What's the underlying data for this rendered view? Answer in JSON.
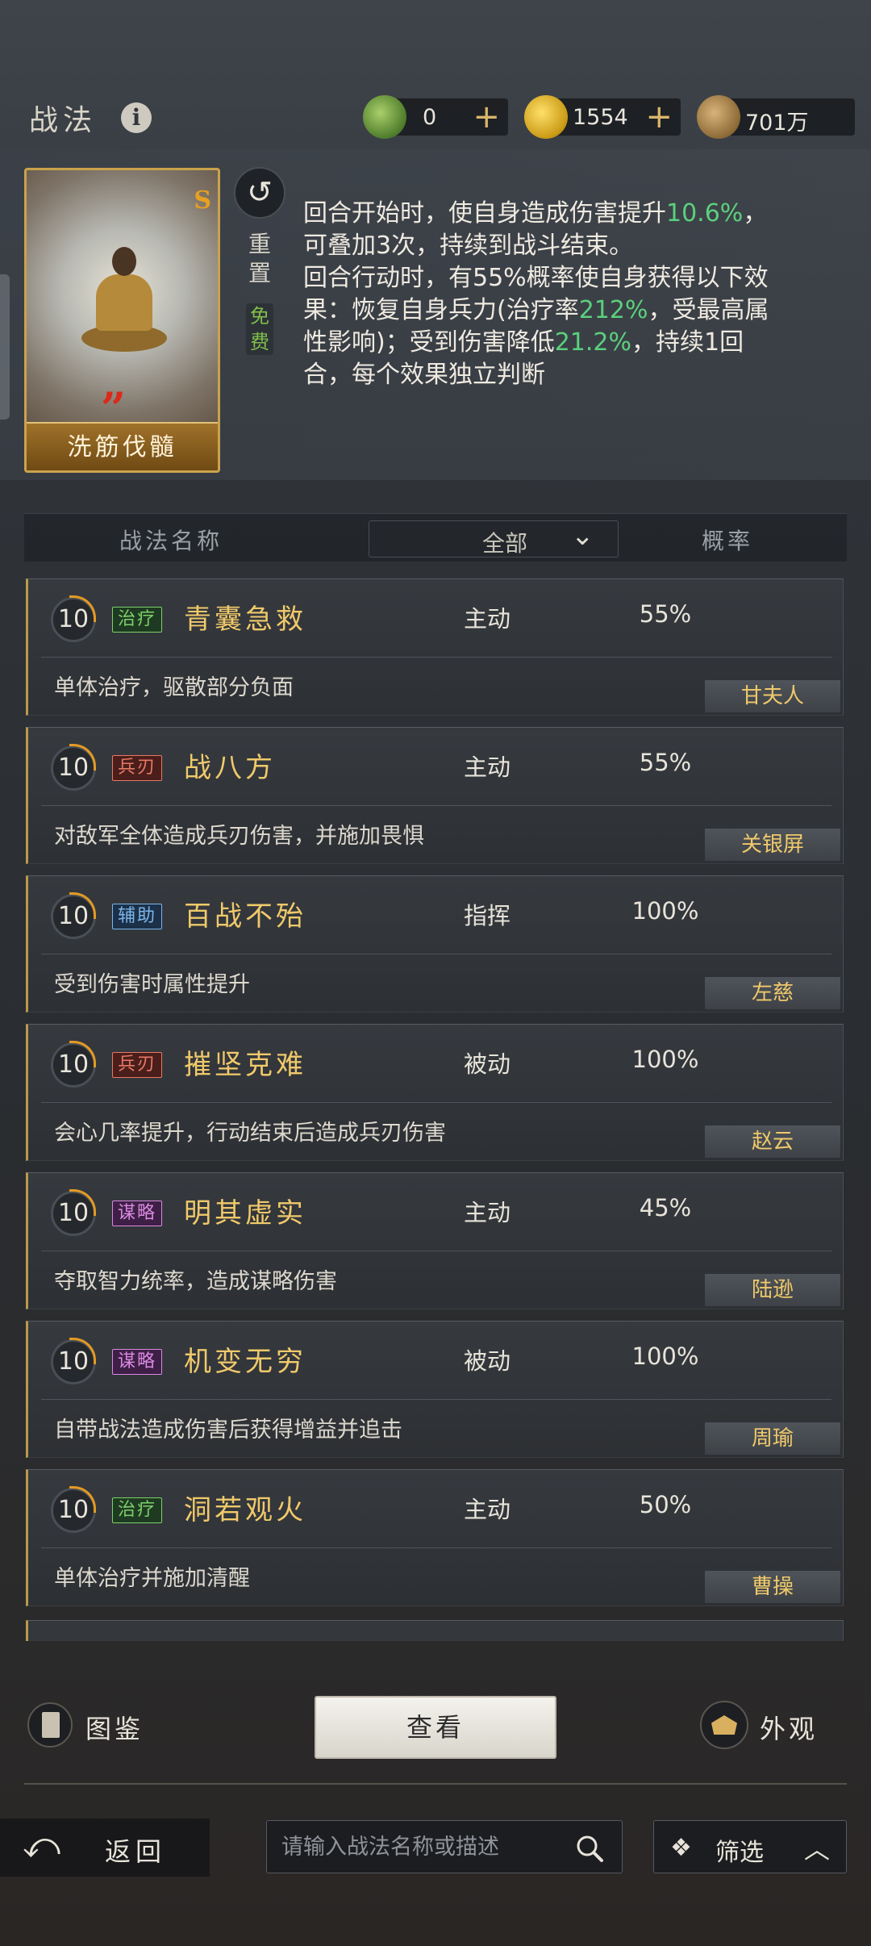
{
  "header": {
    "title": "战法",
    "currencies": [
      {
        "icon": "jade-coin-icon",
        "value": "0",
        "has_add": true
      },
      {
        "icon": "gold-coin-icon",
        "value": "1554",
        "has_add": true
      },
      {
        "icon": "copper-coin-icon",
        "value": "701万",
        "has_add": false
      }
    ],
    "add_symbol": "+"
  },
  "featured": {
    "card_name": "洗筋伐髓",
    "card_rank": "S",
    "reset_label": "重置",
    "free_label": "免费",
    "description": {
      "p1_a": "回合开始时，使自身造成伤害提升",
      "p1_hl": "10.6%",
      "p1_b": "，可叠加3次，持续到战斗结束。",
      "p2_a": "回合行动时，有55%概率使自身获得以下效果：恢复自身兵力(治疗率",
      "p2_hl1": "212%",
      "p2_b": "，受最高属性影响)；受到伤害降低",
      "p2_hl2": "21.2%",
      "p2_c": "，持续1回合，每个效果独立判断"
    }
  },
  "filter_bar": {
    "col_name": "战法名称",
    "dropdown_value": "全部",
    "col_rate": "概率"
  },
  "skills": [
    {
      "level": "10",
      "tag": "治疗",
      "tag_type": "heal",
      "name": "青囊急救",
      "kind": "主动",
      "rate": "55%",
      "desc": "单体治疗，驱散部分负面",
      "owner": "甘夫人"
    },
    {
      "level": "10",
      "tag": "兵刃",
      "tag_type": "blade",
      "name": "战八方",
      "kind": "主动",
      "rate": "55%",
      "desc": "对敌军全体造成兵刃伤害，并施加畏惧",
      "owner": "关银屏"
    },
    {
      "level": "10",
      "tag": "辅助",
      "tag_type": "aux",
      "name": "百战不殆",
      "kind": "指挥",
      "rate": "100%",
      "desc": "受到伤害时属性提升",
      "owner": "左慈"
    },
    {
      "level": "10",
      "tag": "兵刃",
      "tag_type": "blade",
      "name": "摧坚克难",
      "kind": "被动",
      "rate": "100%",
      "desc": "会心几率提升，行动结束后造成兵刃伤害",
      "owner": "赵云"
    },
    {
      "level": "10",
      "tag": "谋略",
      "tag_type": "strat",
      "name": "明其虚实",
      "kind": "主动",
      "rate": "45%",
      "desc": "夺取智力统率，造成谋略伤害",
      "owner": "陆逊"
    },
    {
      "level": "10",
      "tag": "谋略",
      "tag_type": "strat",
      "name": "机变无穷",
      "kind": "被动",
      "rate": "100%",
      "desc": "自带战法造成伤害后获得增益并追击",
      "owner": "周瑜"
    },
    {
      "level": "10",
      "tag": "治疗",
      "tag_type": "heal",
      "name": "洞若观火",
      "kind": "主动",
      "rate": "50%",
      "desc": "单体治疗并施加清醒",
      "owner": "曹操"
    }
  ],
  "bottom": {
    "atlas_label": "图鉴",
    "view_label": "查看",
    "appearance_label": "外观",
    "back_label": "返回",
    "search_placeholder": "请输入战法名称或描述",
    "filter_label": "筛选"
  },
  "colors": {
    "accent_gold": "#f0c96a",
    "highlight_green": "#5bd07c",
    "progress_orange": "#e39a22"
  }
}
